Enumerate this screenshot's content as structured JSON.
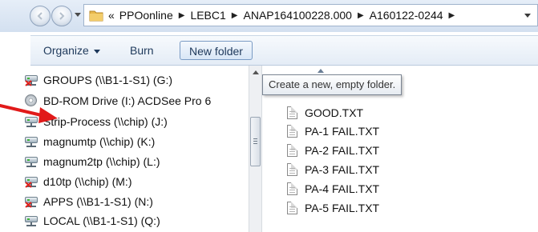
{
  "address_bar": {
    "overflow": "«",
    "crumbs": [
      "PPOonline",
      "LEBC1",
      "ANAP164100228.000",
      "A160122-0244"
    ]
  },
  "toolbar": {
    "organize": "Organize",
    "burn": "Burn",
    "new_folder": "New folder"
  },
  "tooltip": "Create a new, empty folder.",
  "nav_items": [
    {
      "label": "GROUPS (\\\\B1-1-S1) (G:)",
      "icon": "disconnected-network-drive-icon"
    },
    {
      "label": "BD-ROM Drive (I:) ACDSee Pro 6",
      "icon": "bd-rom-drive-icon"
    },
    {
      "label": "Strip-Process (\\\\chip) (J:)",
      "icon": "network-drive-icon"
    },
    {
      "label": "magnumtp (\\\\chip) (K:)",
      "icon": "network-drive-icon"
    },
    {
      "label": "magnum2tp (\\\\chip) (L:)",
      "icon": "network-drive-icon"
    },
    {
      "label": "d10tp (\\\\chip) (M:)",
      "icon": "disconnected-network-drive-icon"
    },
    {
      "label": "APPS (\\\\B1-1-S1) (N:)",
      "icon": "disconnected-network-drive-icon"
    },
    {
      "label": "LOCAL (\\\\B1-1-S1) (Q:)",
      "icon": "network-drive-icon"
    }
  ],
  "files": [
    {
      "name": "GOOD.TXT"
    },
    {
      "name": "PA-1 FAIL.TXT"
    },
    {
      "name": "PA-2 FAIL.TXT"
    },
    {
      "name": "PA-3 FAIL.TXT"
    },
    {
      "name": "PA-4 FAIL.TXT"
    },
    {
      "name": "PA-5 FAIL.TXT"
    }
  ],
  "colors": {
    "annotation_arrow": "#e11a1a",
    "folder_icon": "#e8b84a",
    "toolbar_text": "#1e395b"
  }
}
